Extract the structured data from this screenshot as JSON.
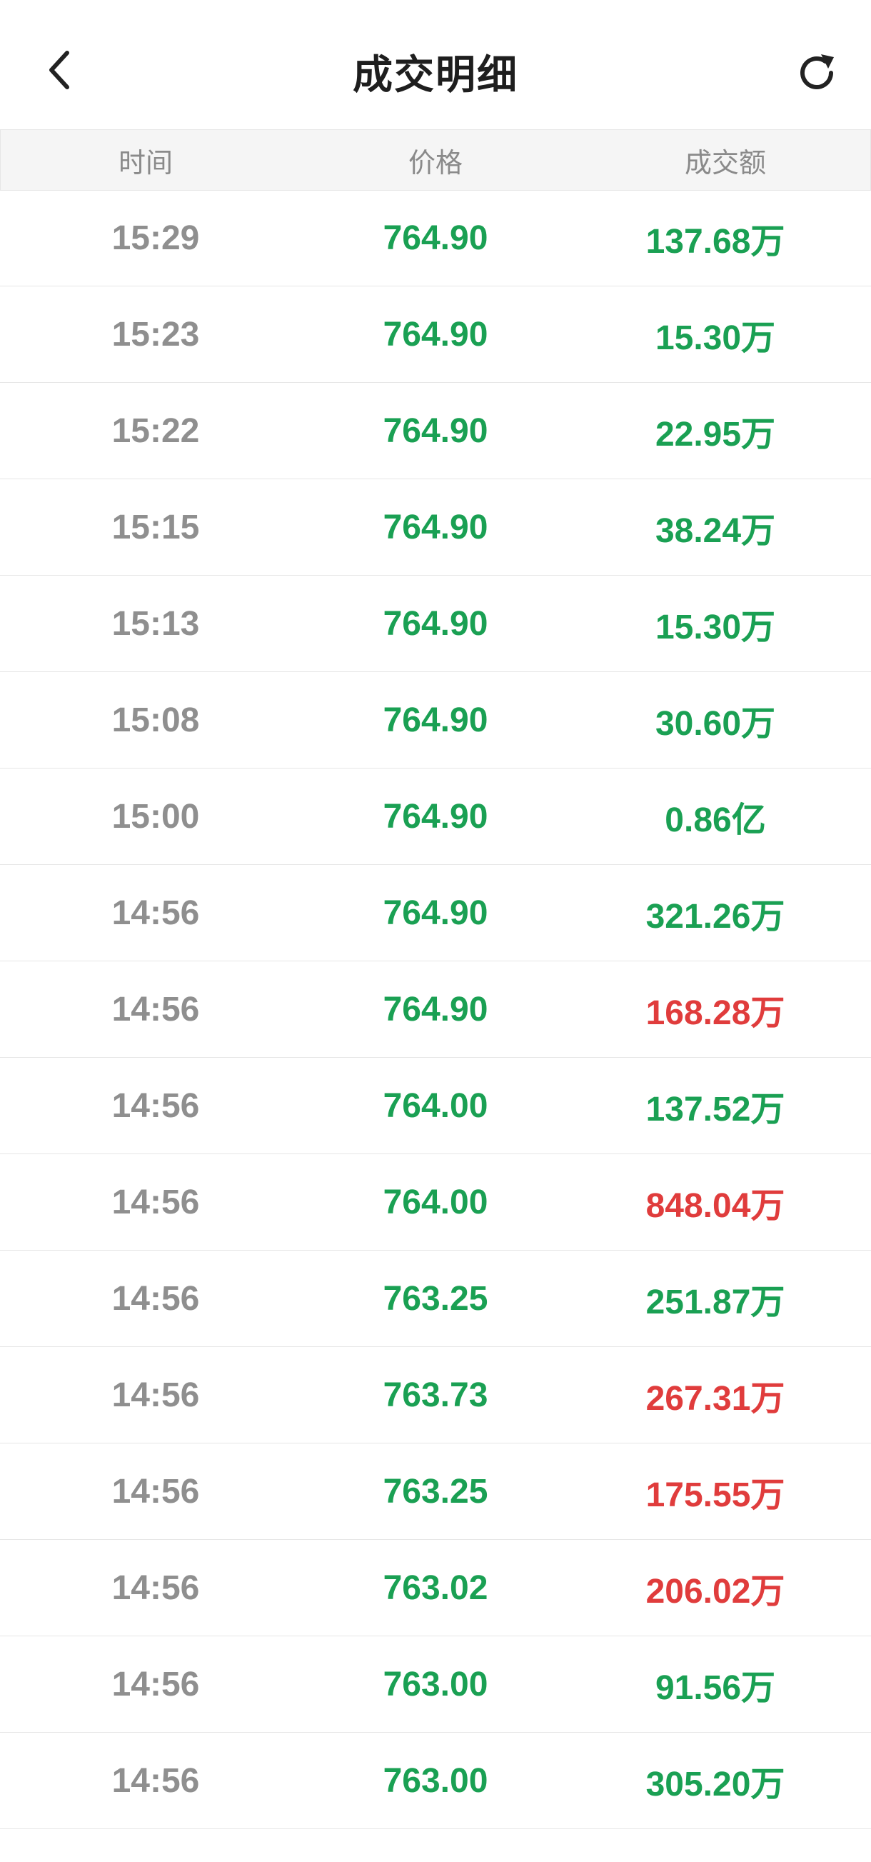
{
  "header": {
    "title": "成交明细",
    "back_icon": "chevron-left-icon",
    "refresh_icon": "refresh-icon"
  },
  "columns": {
    "time": "时间",
    "price": "价格",
    "amount": "成交额"
  },
  "colors": {
    "green": "#1aa053",
    "red": "#e03c3c",
    "gray_text": "#8f8f8f"
  },
  "trades": [
    {
      "time": "15:29",
      "price": "764.90",
      "amount": "137.68万",
      "amount_color": "green"
    },
    {
      "time": "15:23",
      "price": "764.90",
      "amount": "15.30万",
      "amount_color": "green"
    },
    {
      "time": "15:22",
      "price": "764.90",
      "amount": "22.95万",
      "amount_color": "green"
    },
    {
      "time": "15:15",
      "price": "764.90",
      "amount": "38.24万",
      "amount_color": "green"
    },
    {
      "time": "15:13",
      "price": "764.90",
      "amount": "15.30万",
      "amount_color": "green"
    },
    {
      "time": "15:08",
      "price": "764.90",
      "amount": "30.60万",
      "amount_color": "green"
    },
    {
      "time": "15:00",
      "price": "764.90",
      "amount": "0.86亿",
      "amount_color": "green"
    },
    {
      "time": "14:56",
      "price": "764.90",
      "amount": "321.26万",
      "amount_color": "green"
    },
    {
      "time": "14:56",
      "price": "764.90",
      "amount": "168.28万",
      "amount_color": "red"
    },
    {
      "time": "14:56",
      "price": "764.00",
      "amount": "137.52万",
      "amount_color": "green"
    },
    {
      "time": "14:56",
      "price": "764.00",
      "amount": "848.04万",
      "amount_color": "red"
    },
    {
      "time": "14:56",
      "price": "763.25",
      "amount": "251.87万",
      "amount_color": "green"
    },
    {
      "time": "14:56",
      "price": "763.73",
      "amount": "267.31万",
      "amount_color": "red"
    },
    {
      "time": "14:56",
      "price": "763.25",
      "amount": "175.55万",
      "amount_color": "red"
    },
    {
      "time": "14:56",
      "price": "763.02",
      "amount": "206.02万",
      "amount_color": "red"
    },
    {
      "time": "14:56",
      "price": "763.00",
      "amount": "91.56万",
      "amount_color": "green"
    },
    {
      "time": "14:56",
      "price": "763.00",
      "amount": "305.20万",
      "amount_color": "green"
    }
  ]
}
